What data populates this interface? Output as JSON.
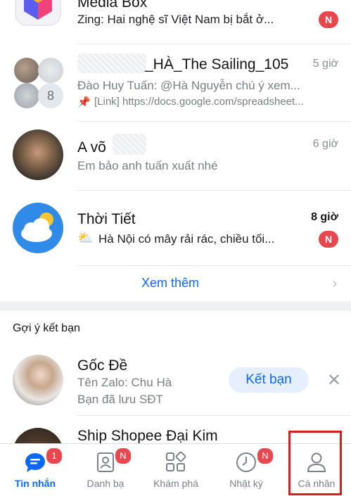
{
  "chats": [
    {
      "name": "Media Box",
      "preview": "Zing: Hai nghệ sĩ Việt Nam bị bắt ở...",
      "badge": "N",
      "avatar_icon": "media-box-logo"
    },
    {
      "name": "_HÀ_The Sailing_105",
      "time": "5 giờ",
      "preview": "Đào Huy Tuấn: @Hà Nguyễn chú ý xem...",
      "pinned_preview": "[Link] https://docs.google.com/spreadsheet...",
      "member_count": "8",
      "pin_icon": "pushpin-icon"
    },
    {
      "name": "A võ",
      "time": "6 giờ",
      "preview": "Em bảo anh tuấn xuất nhé"
    },
    {
      "name": "Thời Tiết",
      "time": "8 giờ",
      "preview": "Hà Nội có mây rải rác, chiều tối...",
      "badge": "N",
      "avatar_icon": "weather-cloud-icon"
    }
  ],
  "see_more": {
    "label": "Xem thêm"
  },
  "suggestions": {
    "title": "Gợi ý kết bạn",
    "items": [
      {
        "name": "Gốc Đề",
        "line1": "Tên Zalo: Chu Hà",
        "line2": "Bạn đã lưu SĐT",
        "button": "Kết bạn"
      },
      {
        "name": "Ship Shopee Đại Kim"
      }
    ]
  },
  "bottom_nav": [
    {
      "label": "Tin nhắn",
      "badge": "1",
      "active": true,
      "icon": "chat-bubble-icon"
    },
    {
      "label": "Danh bạ",
      "badge": "N",
      "active": false,
      "icon": "contacts-icon"
    },
    {
      "label": "Khám phá",
      "badge": "",
      "active": false,
      "icon": "discover-grid-icon"
    },
    {
      "label": "Nhật ký",
      "badge": "N",
      "active": false,
      "icon": "clock-icon"
    },
    {
      "label": "Cá nhân",
      "badge": "",
      "active": false,
      "icon": "person-icon"
    }
  ],
  "colors": {
    "accent": "#0a68fe",
    "badge_red": "#e8474e",
    "highlight_red": "#d61e1e"
  }
}
